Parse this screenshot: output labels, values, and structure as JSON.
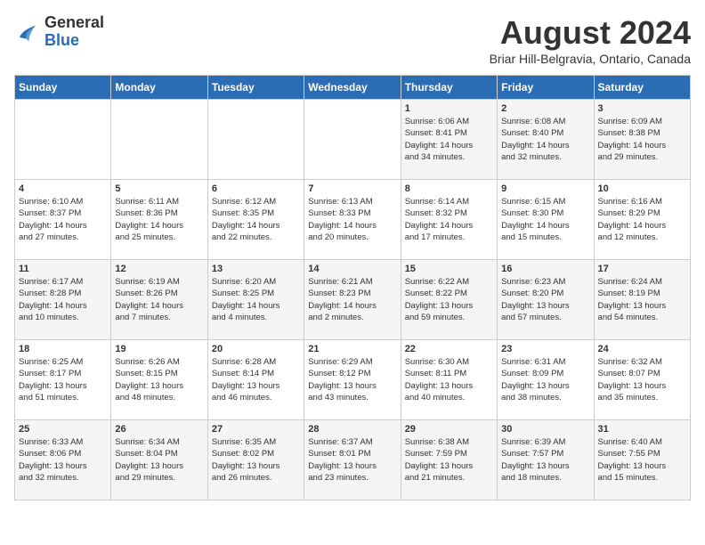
{
  "header": {
    "logo_general": "General",
    "logo_blue": "Blue",
    "month_year": "August 2024",
    "location": "Briar Hill-Belgravia, Ontario, Canada"
  },
  "weekdays": [
    "Sunday",
    "Monday",
    "Tuesday",
    "Wednesday",
    "Thursday",
    "Friday",
    "Saturday"
  ],
  "weeks": [
    [
      {
        "day": "",
        "info": ""
      },
      {
        "day": "",
        "info": ""
      },
      {
        "day": "",
        "info": ""
      },
      {
        "day": "",
        "info": ""
      },
      {
        "day": "1",
        "info": "Sunrise: 6:06 AM\nSunset: 8:41 PM\nDaylight: 14 hours\nand 34 minutes."
      },
      {
        "day": "2",
        "info": "Sunrise: 6:08 AM\nSunset: 8:40 PM\nDaylight: 14 hours\nand 32 minutes."
      },
      {
        "day": "3",
        "info": "Sunrise: 6:09 AM\nSunset: 8:38 PM\nDaylight: 14 hours\nand 29 minutes."
      }
    ],
    [
      {
        "day": "4",
        "info": "Sunrise: 6:10 AM\nSunset: 8:37 PM\nDaylight: 14 hours\nand 27 minutes."
      },
      {
        "day": "5",
        "info": "Sunrise: 6:11 AM\nSunset: 8:36 PM\nDaylight: 14 hours\nand 25 minutes."
      },
      {
        "day": "6",
        "info": "Sunrise: 6:12 AM\nSunset: 8:35 PM\nDaylight: 14 hours\nand 22 minutes."
      },
      {
        "day": "7",
        "info": "Sunrise: 6:13 AM\nSunset: 8:33 PM\nDaylight: 14 hours\nand 20 minutes."
      },
      {
        "day": "8",
        "info": "Sunrise: 6:14 AM\nSunset: 8:32 PM\nDaylight: 14 hours\nand 17 minutes."
      },
      {
        "day": "9",
        "info": "Sunrise: 6:15 AM\nSunset: 8:30 PM\nDaylight: 14 hours\nand 15 minutes."
      },
      {
        "day": "10",
        "info": "Sunrise: 6:16 AM\nSunset: 8:29 PM\nDaylight: 14 hours\nand 12 minutes."
      }
    ],
    [
      {
        "day": "11",
        "info": "Sunrise: 6:17 AM\nSunset: 8:28 PM\nDaylight: 14 hours\nand 10 minutes."
      },
      {
        "day": "12",
        "info": "Sunrise: 6:19 AM\nSunset: 8:26 PM\nDaylight: 14 hours\nand 7 minutes."
      },
      {
        "day": "13",
        "info": "Sunrise: 6:20 AM\nSunset: 8:25 PM\nDaylight: 14 hours\nand 4 minutes."
      },
      {
        "day": "14",
        "info": "Sunrise: 6:21 AM\nSunset: 8:23 PM\nDaylight: 14 hours\nand 2 minutes."
      },
      {
        "day": "15",
        "info": "Sunrise: 6:22 AM\nSunset: 8:22 PM\nDaylight: 13 hours\nand 59 minutes."
      },
      {
        "day": "16",
        "info": "Sunrise: 6:23 AM\nSunset: 8:20 PM\nDaylight: 13 hours\nand 57 minutes."
      },
      {
        "day": "17",
        "info": "Sunrise: 6:24 AM\nSunset: 8:19 PM\nDaylight: 13 hours\nand 54 minutes."
      }
    ],
    [
      {
        "day": "18",
        "info": "Sunrise: 6:25 AM\nSunset: 8:17 PM\nDaylight: 13 hours\nand 51 minutes."
      },
      {
        "day": "19",
        "info": "Sunrise: 6:26 AM\nSunset: 8:15 PM\nDaylight: 13 hours\nand 48 minutes."
      },
      {
        "day": "20",
        "info": "Sunrise: 6:28 AM\nSunset: 8:14 PM\nDaylight: 13 hours\nand 46 minutes."
      },
      {
        "day": "21",
        "info": "Sunrise: 6:29 AM\nSunset: 8:12 PM\nDaylight: 13 hours\nand 43 minutes."
      },
      {
        "day": "22",
        "info": "Sunrise: 6:30 AM\nSunset: 8:11 PM\nDaylight: 13 hours\nand 40 minutes."
      },
      {
        "day": "23",
        "info": "Sunrise: 6:31 AM\nSunset: 8:09 PM\nDaylight: 13 hours\nand 38 minutes."
      },
      {
        "day": "24",
        "info": "Sunrise: 6:32 AM\nSunset: 8:07 PM\nDaylight: 13 hours\nand 35 minutes."
      }
    ],
    [
      {
        "day": "25",
        "info": "Sunrise: 6:33 AM\nSunset: 8:06 PM\nDaylight: 13 hours\nand 32 minutes."
      },
      {
        "day": "26",
        "info": "Sunrise: 6:34 AM\nSunset: 8:04 PM\nDaylight: 13 hours\nand 29 minutes."
      },
      {
        "day": "27",
        "info": "Sunrise: 6:35 AM\nSunset: 8:02 PM\nDaylight: 13 hours\nand 26 minutes."
      },
      {
        "day": "28",
        "info": "Sunrise: 6:37 AM\nSunset: 8:01 PM\nDaylight: 13 hours\nand 23 minutes."
      },
      {
        "day": "29",
        "info": "Sunrise: 6:38 AM\nSunset: 7:59 PM\nDaylight: 13 hours\nand 21 minutes."
      },
      {
        "day": "30",
        "info": "Sunrise: 6:39 AM\nSunset: 7:57 PM\nDaylight: 13 hours\nand 18 minutes."
      },
      {
        "day": "31",
        "info": "Sunrise: 6:40 AM\nSunset: 7:55 PM\nDaylight: 13 hours\nand 15 minutes."
      }
    ]
  ]
}
